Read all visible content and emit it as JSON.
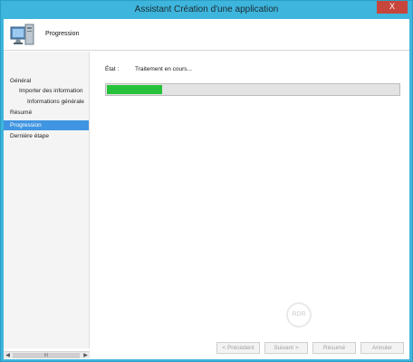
{
  "window": {
    "title": "Assistant Création d'une application",
    "close_label": "X"
  },
  "header": {
    "title": "Progression",
    "icon": "computer-monitor-icon"
  },
  "sidebar": {
    "items": [
      {
        "label": "Général",
        "indent": 0,
        "active": false
      },
      {
        "label": "Importer des information",
        "indent": 1,
        "active": false
      },
      {
        "label": "Informations générale",
        "indent": 2,
        "active": false
      },
      {
        "label": "Résumé",
        "indent": 0,
        "active": false
      },
      {
        "label": "Progression",
        "indent": 0,
        "active": true
      },
      {
        "label": "Dernière étape",
        "indent": 0,
        "active": false
      }
    ],
    "scroll_thumb_label": "III"
  },
  "main": {
    "status_label": "État :",
    "status_value": "Traitement en cours...",
    "progress_fraction": 0.19,
    "progress_color": "#26c23a"
  },
  "footer": {
    "prev_label": "< Précédent",
    "next_label": "Suivant >",
    "summary_label": "Résumé",
    "cancel_label": "Annuler"
  },
  "watermark": {
    "text": "RDR"
  },
  "colors": {
    "frame": "#3eb5dc",
    "selection": "#3f95e1",
    "close": "#c7463c"
  }
}
